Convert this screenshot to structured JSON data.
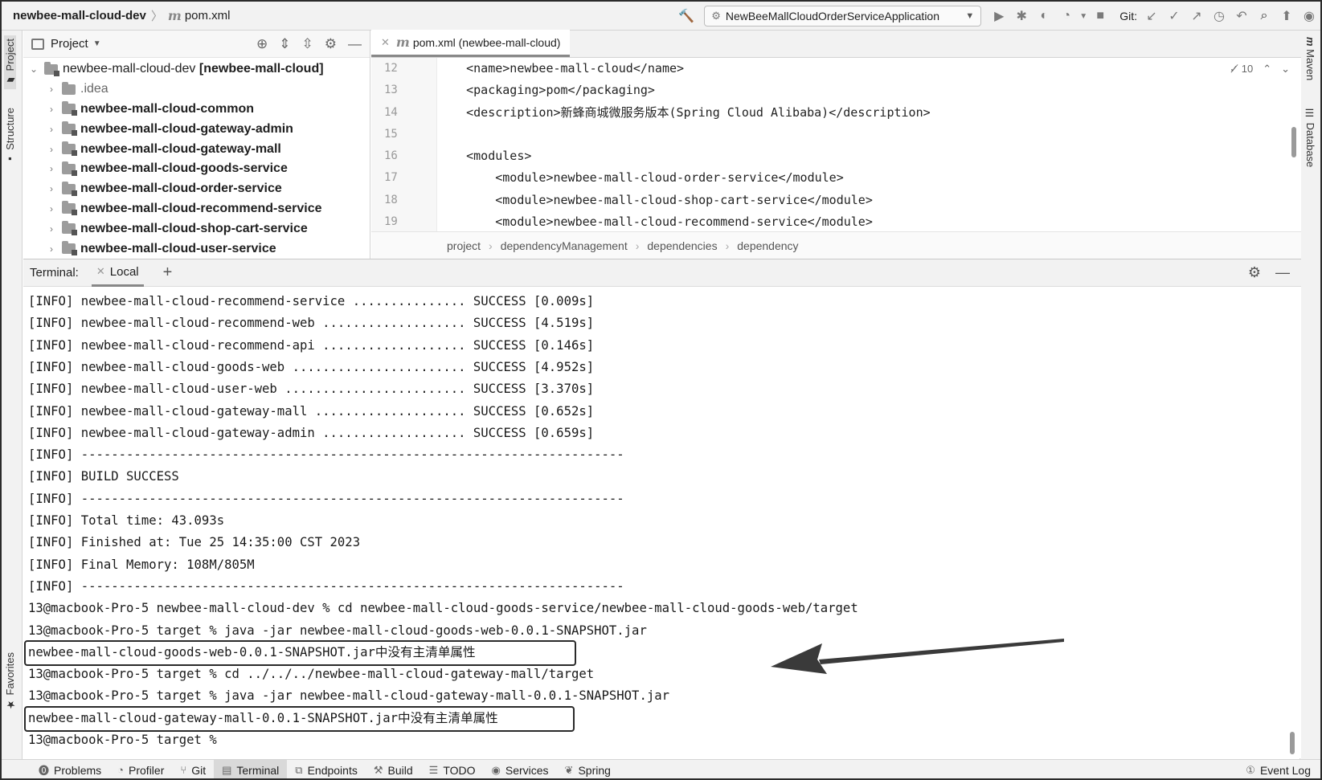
{
  "titlebar": {
    "project_crumb": "newbee-mall-cloud-dev",
    "file_crumb": "pom.xml",
    "run_config": "NewBeeMallCloudOrderServiceApplication",
    "git_label": "Git:"
  },
  "left_strip": {
    "project": "Project",
    "structure": "Structure",
    "favorites": "Favorites"
  },
  "right_strip": {
    "maven": "Maven",
    "database": "Database"
  },
  "project_panel": {
    "title": "Project",
    "tree": [
      {
        "label": "newbee-mall-cloud-dev",
        "suffix": "[newbee-mall-cloud]",
        "expanded": true,
        "level": 0
      },
      {
        "label": ".idea",
        "level": 1,
        "muted": true
      },
      {
        "label": "newbee-mall-cloud-common",
        "level": 1
      },
      {
        "label": "newbee-mall-cloud-gateway-admin",
        "level": 1
      },
      {
        "label": "newbee-mall-cloud-gateway-mall",
        "level": 1
      },
      {
        "label": "newbee-mall-cloud-goods-service",
        "level": 1
      },
      {
        "label": "newbee-mall-cloud-order-service",
        "level": 1
      },
      {
        "label": "newbee-mall-cloud-recommend-service",
        "level": 1
      },
      {
        "label": "newbee-mall-cloud-shop-cart-service",
        "level": 1
      },
      {
        "label": "newbee-mall-cloud-user-service",
        "level": 1
      }
    ]
  },
  "editor": {
    "tab_label": "pom.xml (newbee-mall-cloud)",
    "inspection_count": "10",
    "lines": [
      {
        "num": "12",
        "code": "    <name>newbee-mall-cloud</name>"
      },
      {
        "num": "13",
        "code": "    <packaging>pom</packaging>"
      },
      {
        "num": "14",
        "code": "    <description>新蜂商城微服务版本(Spring Cloud Alibaba)</description>"
      },
      {
        "num": "15",
        "code": ""
      },
      {
        "num": "16",
        "code": "    <modules>"
      },
      {
        "num": "17",
        "code": "        <module>newbee-mall-cloud-order-service</module>"
      },
      {
        "num": "18",
        "code": "        <module>newbee-mall-cloud-shop-cart-service</module>"
      },
      {
        "num": "19",
        "code": "        <module>newbee-mall-cloud-recommend-service</module>"
      }
    ],
    "breadcrumb": [
      "project",
      "dependencyManagement",
      "dependencies",
      "dependency"
    ]
  },
  "terminal": {
    "label": "Terminal:",
    "tab": "Local",
    "lines": [
      "[INFO] newbee-mall-cloud-recommend-service ............... SUCCESS [0.009s]",
      "[INFO] newbee-mall-cloud-recommend-web ................... SUCCESS [4.519s]",
      "[INFO] newbee-mall-cloud-recommend-api ................... SUCCESS [0.146s]",
      "[INFO] newbee-mall-cloud-goods-web ....................... SUCCESS [4.952s]",
      "[INFO] newbee-mall-cloud-user-web ........................ SUCCESS [3.370s]",
      "[INFO] newbee-mall-cloud-gateway-mall .................... SUCCESS [0.652s]",
      "[INFO] newbee-mall-cloud-gateway-admin ................... SUCCESS [0.659s]",
      "[INFO] ------------------------------------------------------------------------",
      "[INFO] BUILD SUCCESS",
      "[INFO] ------------------------------------------------------------------------",
      "[INFO] Total time: 43.093s",
      "[INFO] Finished at: Tue 25 14:35:00 CST 2023",
      "[INFO] Final Memory: 108M/805M",
      "[INFO] ------------------------------------------------------------------------",
      "13@macbook-Pro-5 newbee-mall-cloud-dev % cd newbee-mall-cloud-goods-service/newbee-mall-cloud-goods-web/target",
      "13@macbook-Pro-5 target % java -jar newbee-mall-cloud-goods-web-0.0.1-SNAPSHOT.jar",
      "newbee-mall-cloud-goods-web-0.0.1-SNAPSHOT.jar中没有主清单属性",
      "13@macbook-Pro-5 target % cd ../../../newbee-mall-cloud-gateway-mall/target",
      "13@macbook-Pro-5 target % java -jar newbee-mall-cloud-gateway-mall-0.0.1-SNAPSHOT.jar",
      "newbee-mall-cloud-gateway-mall-0.0.1-SNAPSHOT.jar中没有主清单属性",
      "13@macbook-Pro-5 target %"
    ]
  },
  "statusbar": {
    "items": [
      {
        "label": "Problems",
        "icon": "problems-icon"
      },
      {
        "label": "Profiler",
        "icon": "profiler-icon"
      },
      {
        "label": "Git",
        "icon": "git-icon"
      },
      {
        "label": "Terminal",
        "icon": "terminal-icon",
        "active": true
      },
      {
        "label": "Endpoints",
        "icon": "endpoints-icon"
      },
      {
        "label": "Build",
        "icon": "build-icon"
      },
      {
        "label": "TODO",
        "icon": "todo-icon"
      },
      {
        "label": "Services",
        "icon": "services-icon"
      },
      {
        "label": "Spring",
        "icon": "spring-icon"
      }
    ],
    "event_log": "Event Log"
  },
  "colors": {
    "frame": "#2b2b2b",
    "toolbar_bg": "#f2f2f2",
    "highlight_box": "#2a2a2a",
    "arrow": "#3a3a3a"
  }
}
